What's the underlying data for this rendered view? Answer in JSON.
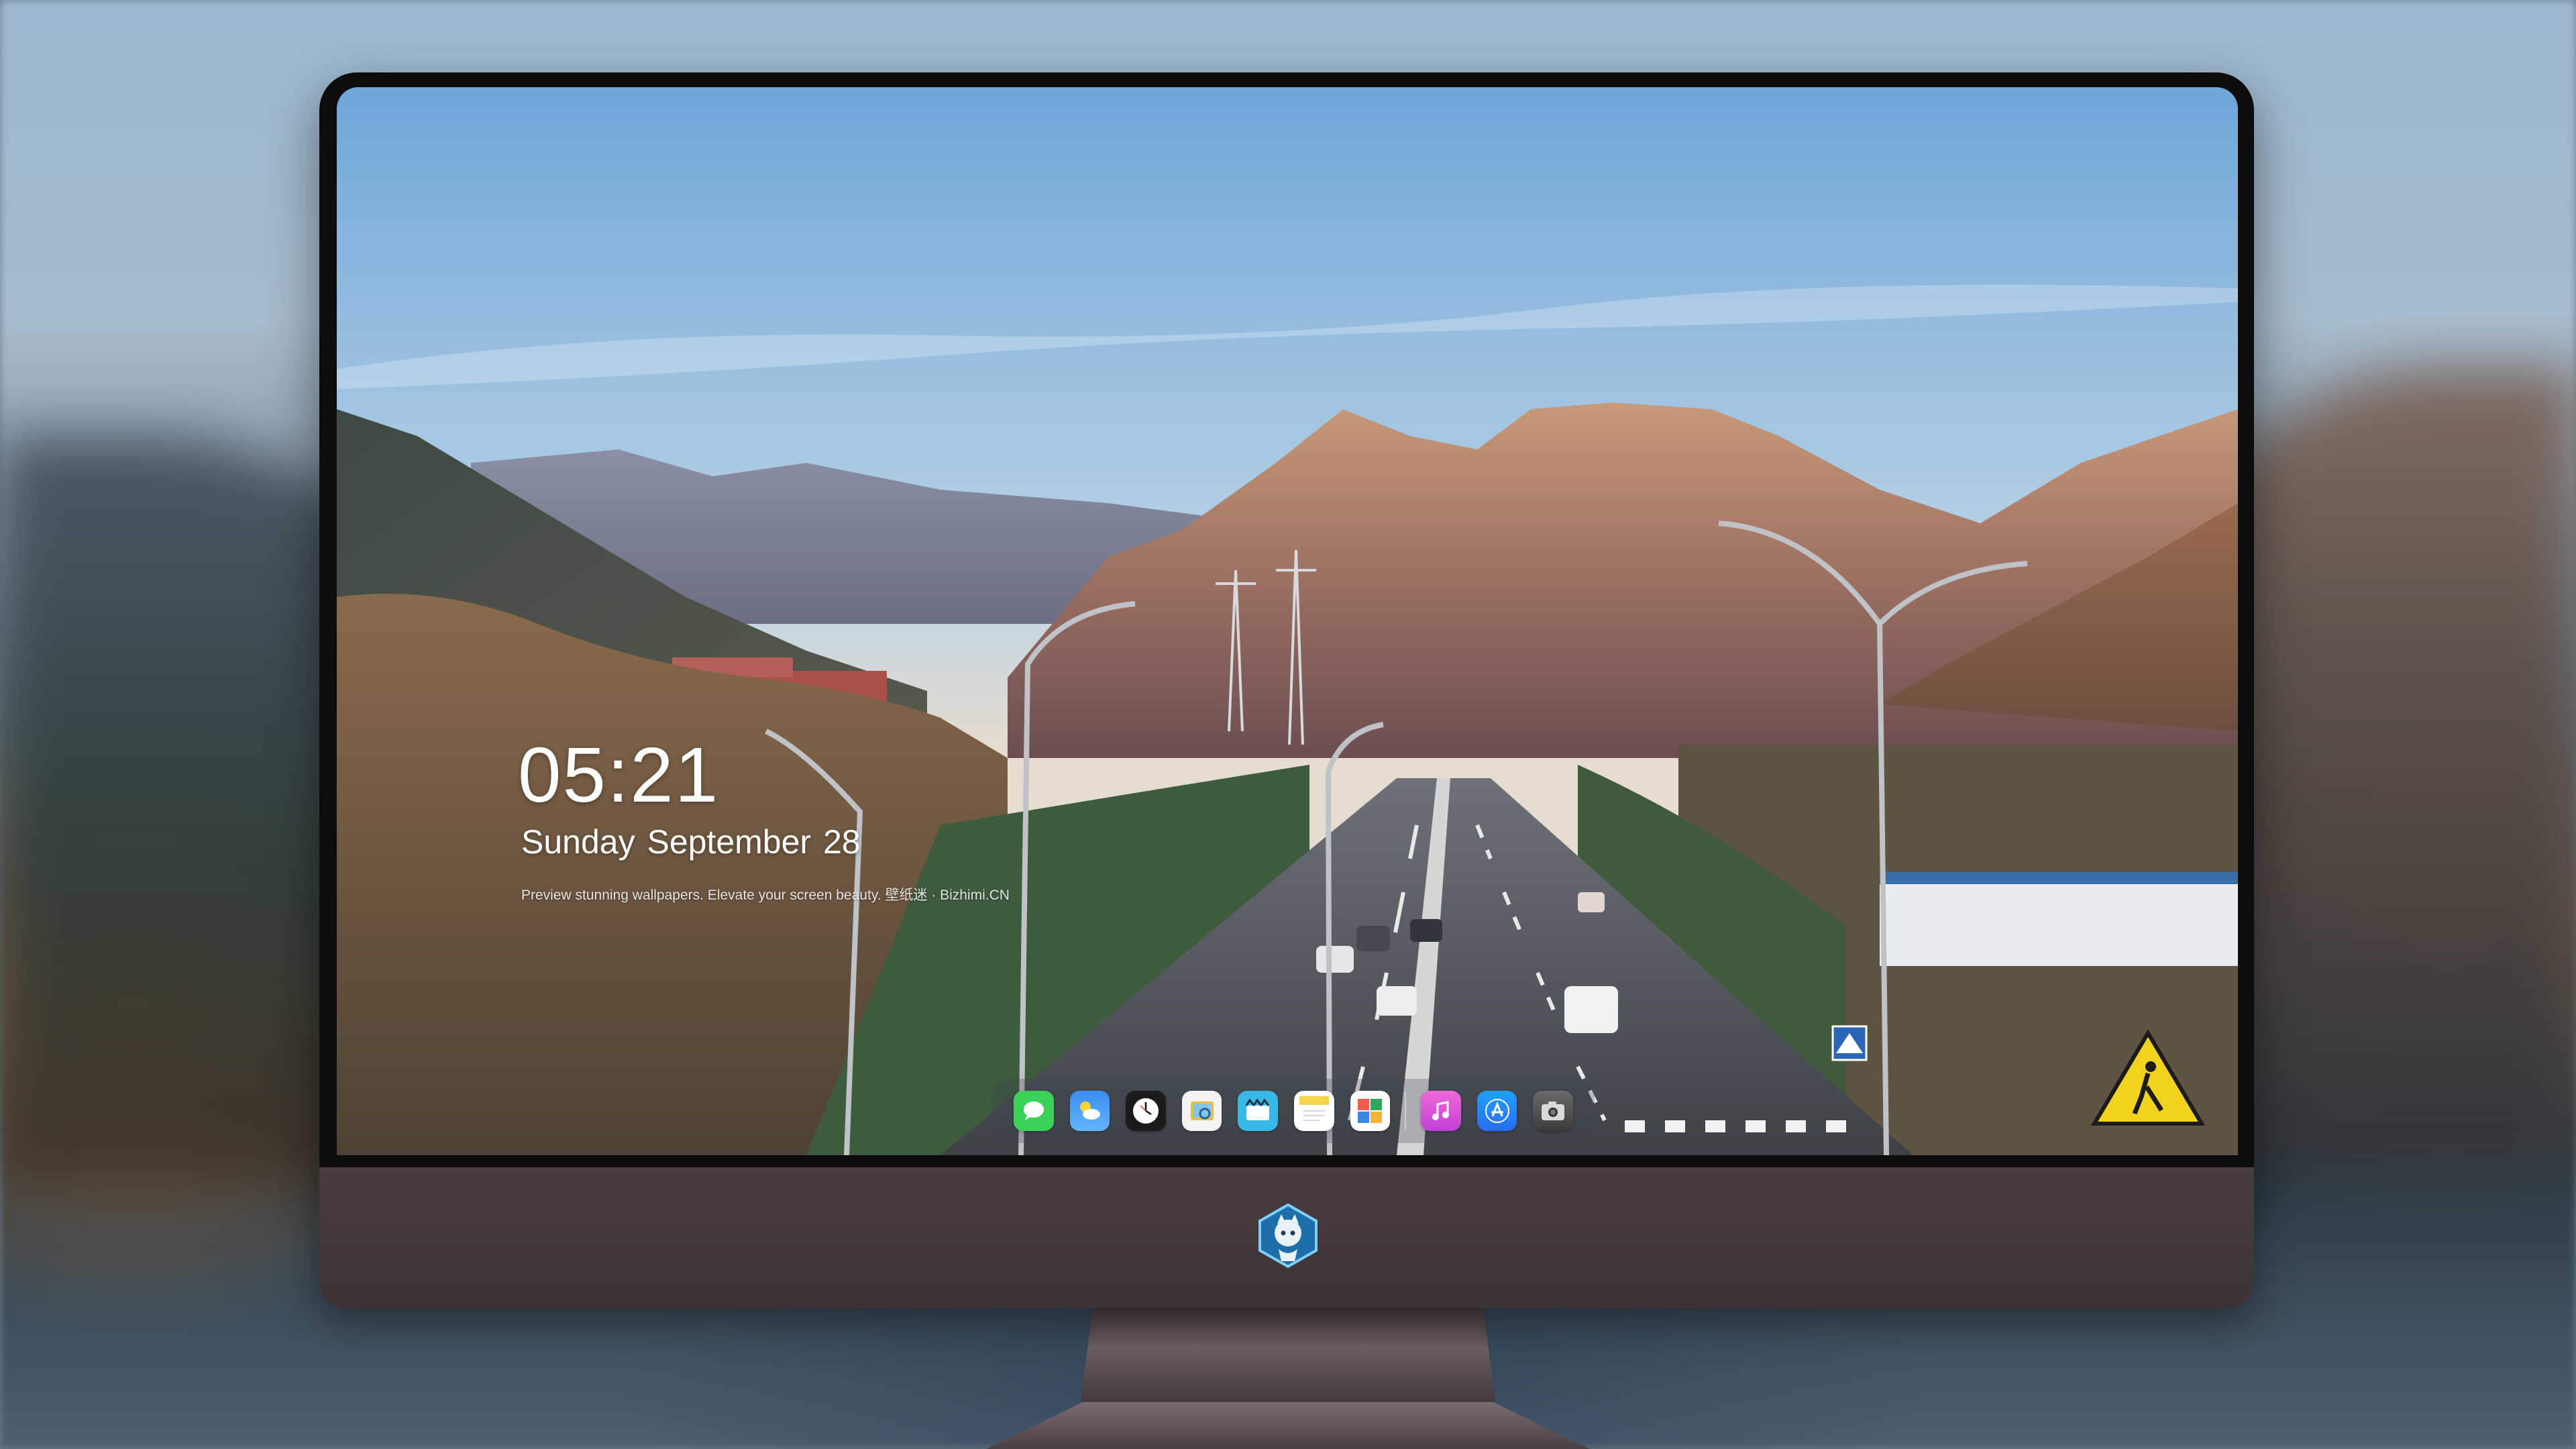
{
  "lockscreen": {
    "time": "05:21",
    "date": "Sunday September  28",
    "tagline": "Preview stunning wallpapers. Elevate your screen beauty. 壁纸迷 · Bizhimi.CN"
  },
  "dock": {
    "apps": [
      {
        "name": "messages-app-icon",
        "color": "#3cd259"
      },
      {
        "name": "weather-app-icon",
        "color": "#3a8ef2"
      },
      {
        "name": "clock-app-icon",
        "color": "#1b1b1b"
      },
      {
        "name": "preview-app-icon",
        "color": "#e7c043"
      },
      {
        "name": "clips-app-icon",
        "color": "#38b8e6"
      },
      {
        "name": "notes-app-icon",
        "color": "#f7d54a"
      },
      {
        "name": "photo-booth-app-icon",
        "color": "#2fa85f"
      },
      {
        "name": "music-app-icon",
        "color": "#e74dc7"
      },
      {
        "name": "app-store-app-icon",
        "color": "#2b87f4"
      },
      {
        "name": "camera-app-icon",
        "color": "#4f4f4f"
      }
    ]
  },
  "colors": {
    "monitor_bezel": "#0e0c0d",
    "monitor_chin": "#4a3d42",
    "text": "#ffffff"
  }
}
